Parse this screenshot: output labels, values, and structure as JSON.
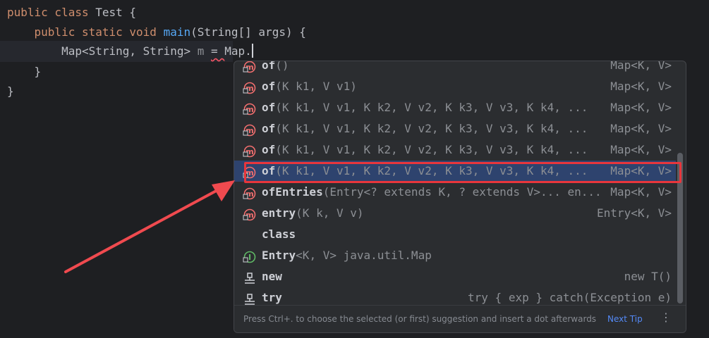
{
  "code": {
    "line1": {
      "kw": "public class",
      "name": " Test {"
    },
    "line2": {
      "indent": "    ",
      "kw": "public static void",
      "fn": "main",
      "rest": "(String[] args) {"
    },
    "line3": {
      "indent": "        ",
      "type": "Map<String, String>",
      "var": " m ",
      "eq": "= ",
      "expr": "Map."
    },
    "line4": {
      "text": "    }"
    },
    "line5": {
      "text": "}"
    }
  },
  "completion": {
    "items": [
      {
        "icon": "method-icon",
        "name": "of",
        "params": "()",
        "type": "Map<K, V>"
      },
      {
        "icon": "method-icon",
        "name": "of",
        "params": "(K k1, V v1)",
        "type": "Map<K, V>"
      },
      {
        "icon": "method-icon",
        "name": "of",
        "params": "(K k1, V v1, K k2, V v2, K k3, V v3, K k4, ...",
        "type": "Map<K, V>"
      },
      {
        "icon": "method-icon",
        "name": "of",
        "params": "(K k1, V v1, K k2, V v2, K k3, V v3, K k4, ...",
        "type": "Map<K, V>"
      },
      {
        "icon": "method-icon",
        "name": "of",
        "params": "(K k1, V v1, K k2, V v2, K k3, V v3, K k4, ...",
        "type": "Map<K, V>"
      },
      {
        "icon": "method-icon",
        "name": "of",
        "params": "(K k1, V v1, K k2, V v2, K k3, V v3, K k4, ...",
        "type": "Map<K, V>",
        "selected": true
      },
      {
        "icon": "method-icon",
        "name": "ofEntries",
        "params": "(Entry<? extends K, ? extends V>... en...",
        "type": "Map<K, V>"
      },
      {
        "icon": "method-icon",
        "name": "entry",
        "params": "(K k, V v)",
        "type": "Entry<K, V>"
      },
      {
        "icon": "none",
        "name": "class",
        "params": "",
        "type": ""
      },
      {
        "icon": "interface-icon",
        "name": "Entry",
        "params": "<K, V> java.util.Map",
        "type": ""
      },
      {
        "icon": "template-icon",
        "name": "new",
        "params": "",
        "type": "new T()"
      },
      {
        "icon": "template-icon",
        "name": "try",
        "params": "",
        "type": "try { exp } catch(Exception e)"
      }
    ],
    "footer_hint": "Press Ctrl+. to choose the selected (or first) suggestion and insert a dot afterwards",
    "next_tip": "Next Tip",
    "more": "⋮"
  },
  "colors": {
    "selection": "#2e436e",
    "highlight_box": "#e8363c",
    "arrow": "#f04a4f"
  }
}
